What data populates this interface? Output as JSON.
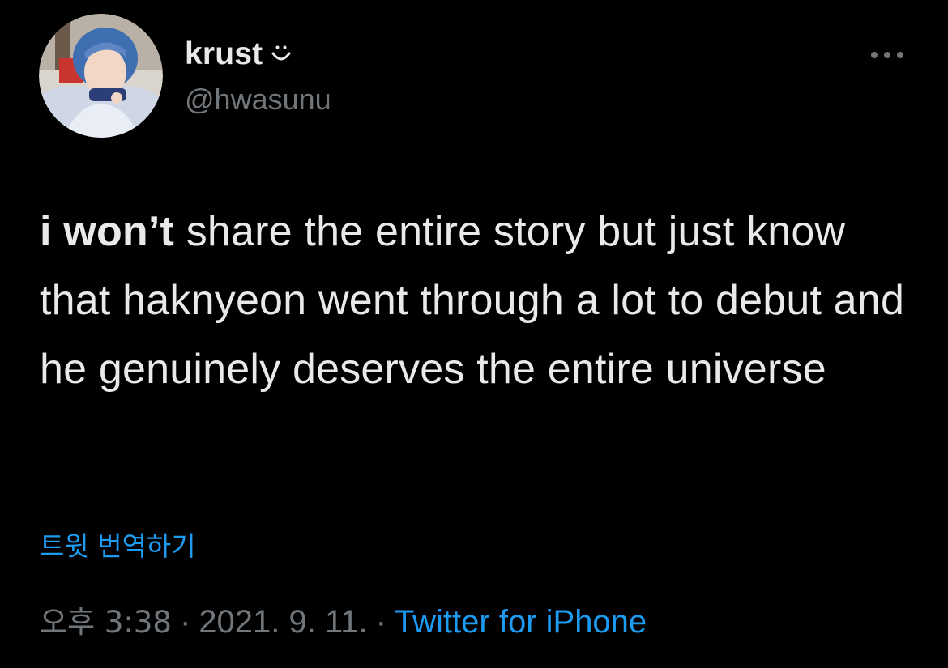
{
  "tweet": {
    "author": {
      "display_name": "krust",
      "name_emoji": "smile-face",
      "handle": "@hwasunu",
      "avatar": "profile-photo"
    },
    "more_icon": "ellipsis-icon",
    "text_bold": "i won’t",
    "text_rest": " share the entire story but just know that haknyeon went through a lot to debut and he genuinely deserves the entire universe",
    "translate_label": "트윗 번역하기",
    "time": "오후 3:38",
    "separator": "·",
    "date": "2021. 9. 11.",
    "source": "Twitter for iPhone",
    "colors": {
      "background": "#000000",
      "text": "#e7e9ea",
      "muted": "#71767b",
      "link": "#1d9bf0"
    }
  }
}
